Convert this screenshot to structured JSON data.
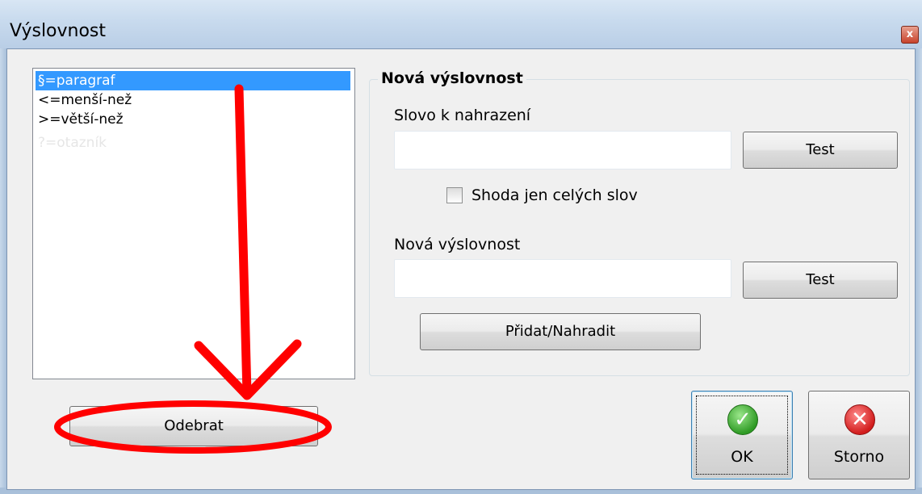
{
  "window": {
    "title": "Výslovnost",
    "close_glyph": "x"
  },
  "list": {
    "items": [
      {
        "label": "§=paragraf",
        "selected": true
      },
      {
        "label": "<=menší-než",
        "selected": false
      },
      {
        "label": ">=větší-než",
        "selected": false
      },
      {
        "label": "?=otazník",
        "selected": false,
        "faded": true
      }
    ]
  },
  "group": {
    "title": "Nová výslovnost",
    "word_label": "Slovo k nahrazení",
    "word_value": "",
    "test_label_1": "Test",
    "whole_words_label": "Shoda jen celých slov",
    "whole_words_checked": false,
    "pronunciation_label": "Nová výslovnost",
    "pronunciation_value": "",
    "test_label_2": "Test",
    "add_replace_label": "Přidat/Nahradit"
  },
  "buttons": {
    "remove_label": "Odebrat",
    "ok_label": "OK",
    "cancel_label": "Storno"
  },
  "icons": {
    "ok": "checkmark-circle-icon",
    "cancel": "x-circle-icon"
  },
  "colors": {
    "selection": "#3399ff",
    "annotation": "#ff0000",
    "ok_icon": "#2f9b25",
    "cancel_icon": "#d21d1d"
  }
}
